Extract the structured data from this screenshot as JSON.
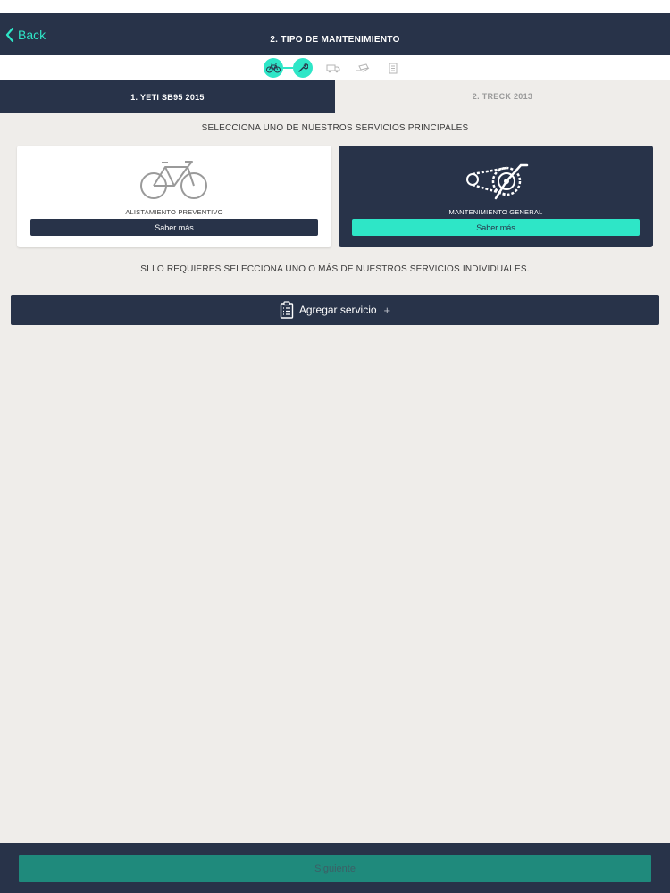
{
  "nav": {
    "back_label": "Back",
    "title": "2. TIPO DE MANTENIMIENTO"
  },
  "progress": {
    "steps": [
      {
        "icon": "bicycle-icon",
        "state": "done"
      },
      {
        "icon": "wrench-icon",
        "state": "current"
      },
      {
        "icon": "truck-icon",
        "state": "pending"
      },
      {
        "icon": "hand-money-icon",
        "state": "pending"
      },
      {
        "icon": "receipt-icon",
        "state": "pending"
      }
    ]
  },
  "bike_tabs": [
    {
      "label": "1. YETI SB95 2015",
      "active": true
    },
    {
      "label": "2. TRECK 2013",
      "active": false
    }
  ],
  "main_services": {
    "heading": "SELECCIONA UNO DE NUESTROS SERVICIOS PRINCIPALES",
    "cards": [
      {
        "label": "ALISTAMIENTO PREVENTIVO",
        "button": "Saber más",
        "icon": "bicycle-icon",
        "selected": false
      },
      {
        "label": "MANTENIMIENTO GENERAL",
        "button": "Saber más",
        "icon": "chainring-icon",
        "selected": true
      }
    ]
  },
  "individual_services": {
    "heading": "SI LO REQUIERES SELECCIONA UNO O MÁS DE NUESTROS SERVICIOS INDIVIDUALES.",
    "add_label": "Agregar servicio",
    "add_icon": "clipboard-icon",
    "plus": "+"
  },
  "footer": {
    "next_label": "Siguiente"
  },
  "colors": {
    "navy": "#283349",
    "accent": "#2ee6c7",
    "background": "#efedea",
    "next_disabled": "#1f8a7c"
  }
}
